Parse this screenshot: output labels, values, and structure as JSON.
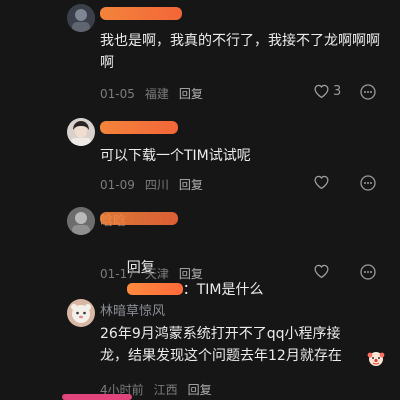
{
  "comments": [
    {
      "text": "我也是啊，我真的不行了，我接不了龙啊啊啊啊",
      "date": "01-05",
      "location": "福建",
      "reply_label": "回复",
      "likes": "3"
    },
    {
      "text": "可以下载一个TIM试试呢",
      "date": "01-09",
      "location": "四川",
      "reply_label": "回复",
      "likes": ""
    },
    {
      "name_partial": "晗晗",
      "reply_prefix": "回复",
      "text_after": "：TIM是什么",
      "date": "01-17",
      "location": "天津",
      "reply_label": "回复",
      "likes": ""
    },
    {
      "name": "林暗草惊风",
      "text": "26年9月鸿蒙系统打开不了qq小程序接龙，结果发现这个问题去年12月就存在",
      "date": "4小时前",
      "location": "江西",
      "reply_label": "回复",
      "likes": ""
    }
  ]
}
